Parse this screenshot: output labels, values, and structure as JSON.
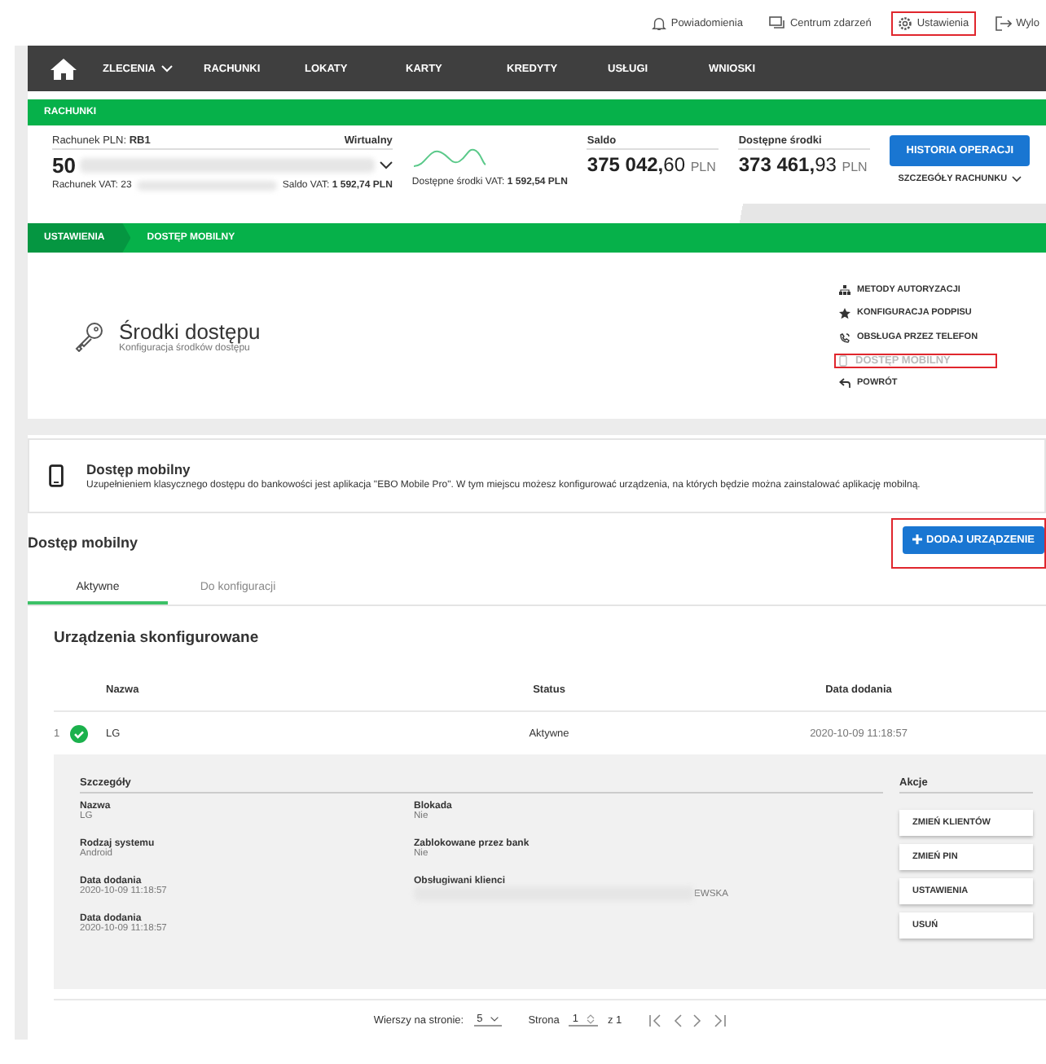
{
  "top_links": [
    {
      "kind": "bell",
      "label": "Powiadomienia",
      "highlighted": false
    },
    {
      "kind": "chat",
      "label": "Centrum zdarzeń",
      "highlighted": false
    },
    {
      "kind": "gear",
      "label": "Ustawienia",
      "highlighted": true
    },
    {
      "kind": "logout",
      "label": "Wylo",
      "highlighted": false
    }
  ],
  "nav": {
    "items": [
      {
        "label": "ZLECENIA",
        "dropdown": true
      },
      {
        "label": "RACHUNKI",
        "dropdown": false
      },
      {
        "label": "LOKATY",
        "dropdown": false
      },
      {
        "label": "KARTY",
        "dropdown": false
      },
      {
        "label": "KREDYTY",
        "dropdown": false
      },
      {
        "label": "USŁUGI",
        "dropdown": false
      },
      {
        "label": "WNIOSKI",
        "dropdown": false
      }
    ]
  },
  "account": {
    "section_title": "RACHUNKI",
    "account_label": "Rachunek PLN:",
    "account_name": "RB1",
    "type": "Wirtualny",
    "number_prefix": "50",
    "vat_label": "Rachunek VAT: 23",
    "vat_balance_label": "Saldo VAT:",
    "vat_balance": "1 592,74 PLN",
    "vat_available_label": "Dostępne środki VAT:",
    "vat_available": "1 592,54 PLN",
    "balance_label": "Saldo",
    "balance_main": "375 042,",
    "balance_cents": "60",
    "balance_currency": "PLN",
    "available_label": "Dostępne środki",
    "available_main": "373 461,",
    "available_cents": "93",
    "available_currency": "PLN",
    "history_button": "HISTORIA OPERACJI",
    "details_link": "SZCZEGÓŁY RACHUNKU"
  },
  "breadcrumb": [
    "USTAWIENIA",
    "DOSTĘP MOBILNY"
  ],
  "settings": {
    "title": "Środki dostępu",
    "subtitle": "Konfiguracja środków dostępu",
    "menu": [
      {
        "kind": "sitemap",
        "label": "METODY AUTORYZACJI",
        "selected": false,
        "highlighted": false
      },
      {
        "kind": "star",
        "label": "KONFIGURACJA PODPISU",
        "selected": false,
        "highlighted": false
      },
      {
        "kind": "phone",
        "label": "OBSŁUGA PRZEZ TELEFON",
        "selected": false,
        "highlighted": false
      },
      {
        "kind": "mobile",
        "label": "DOSTĘP MOBILNY",
        "selected": true,
        "highlighted": true
      },
      {
        "kind": "back",
        "label": "POWRÓT",
        "selected": false,
        "highlighted": false
      }
    ]
  },
  "info": {
    "title": "Dostęp mobilny",
    "text": "Uzupełnieniem klasycznego dostępu do bankowości jest aplikacja \"EBO Mobile Pro\". W tym miejscu możesz konfigurować urządzenia, na których będzie można zainstalować aplikację mobilną."
  },
  "section": {
    "title": "Dostęp mobilny",
    "add_button": "DODAJ URZĄDZENIE",
    "add_button_highlighted": true
  },
  "tabs": [
    {
      "label": "Aktywne",
      "selected": true
    },
    {
      "label": "Do konfiguracji",
      "selected": false
    }
  ],
  "table": {
    "title": "Urządzenia skonfigurowane",
    "columns": [
      "Nazwa",
      "Status",
      "Data dodania"
    ],
    "rows": [
      {
        "index": "1",
        "active": true,
        "name": "LG",
        "status": "Aktywne",
        "date": "2020-10-09 11:18:57",
        "expanded": true
      }
    ],
    "details": {
      "title": "Szczegóły",
      "left_fields": [
        {
          "label": "Nazwa",
          "value": "LG",
          "redacted": false
        },
        {
          "label": "Rodzaj systemu",
          "value": "Android",
          "redacted": false
        },
        {
          "label": "Data dodania",
          "value": "2020-10-09 11:18:57",
          "redacted": false
        },
        {
          "label": "Data dodania",
          "value": "2020-10-09 11:18:57",
          "redacted": false
        }
      ],
      "right_fields": [
        {
          "label": "Blokada",
          "value": "Nie",
          "redacted": false
        },
        {
          "label": "Zablokowane przez bank",
          "value": "Nie",
          "redacted": false
        },
        {
          "label": "Obsługiwani klienci",
          "value": "EWSKA",
          "redacted": true
        }
      ],
      "actions_title": "Akcje",
      "actions": [
        "ZMIEŃ KLIENTÓW",
        "ZMIEŃ PIN",
        "USTAWIENIA",
        "USUŃ"
      ]
    }
  },
  "pagination": {
    "rows_label": "Wierszy na stronie:",
    "rows_value": "5",
    "page_label": "Strona",
    "page_value": "1",
    "of_label": "z 1"
  }
}
